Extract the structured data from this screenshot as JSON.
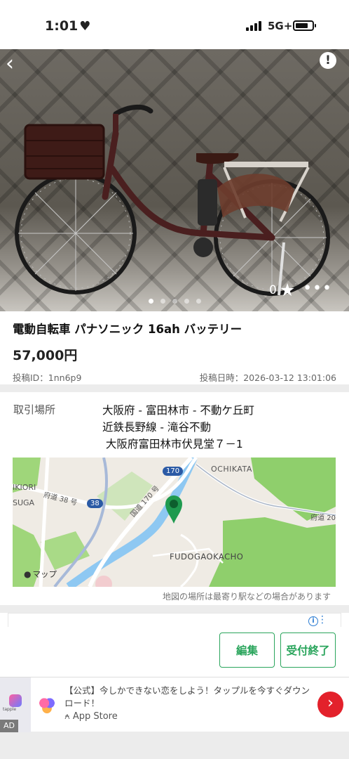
{
  "status_bar": {
    "time": "1:01",
    "network": "5G+",
    "heart_icon": "heart-icon",
    "battery_level_percent": 75
  },
  "photo": {
    "favorite_count": "0",
    "image_count": 5,
    "active_index": 0,
    "icons": {
      "back": "chevron-left-icon",
      "report": "exclamation-icon",
      "favorite": "star-icon",
      "more": "ellipsis-icon"
    }
  },
  "item": {
    "title": "電動自転車 パナソニック 16ah バッテリー",
    "price": "57,000円",
    "post_id": "投稿ID：1nn6p9",
    "post_date": "投稿日時：2026-03-12 13:01:06"
  },
  "place": {
    "label": "取引場所",
    "lines": [
      "大阪府 - 富田林市 - 不動ケ丘町",
      "近鉄長野線 - 滝谷不動",
      " 大阪府富田林市伏見堂７－1"
    ],
    "note": "地図の場所は最寄り駅などの場合があります"
  },
  "map": {
    "labels": {
      "ochikata": "OCHIKATA",
      "ikiori": "IKIORI",
      "suga": "SUGA",
      "route38": "府道 38 号",
      "route170": "国道 170 号",
      "prefroad": "府道 20",
      "fudoga": "FUDOGAOKACHO",
      "shield170": "170",
      "shield38": "38",
      "brand": "マップ"
    },
    "icons": {
      "pin": "map-pin-icon",
      "apple": "apple-icon"
    }
  },
  "actions": {
    "edit": "編集",
    "close": "受付終了"
  },
  "ad": {
    "badge": "AD",
    "thumb_name": "tapple",
    "text": "【公式】今しかできない恋をしよう！タップルを今すぐダウンロード！",
    "store": "App Store",
    "icons": {
      "info": "info-icon",
      "menu": "kebab-icon",
      "store": "app-store-icon",
      "go": "chevron-right-icon"
    }
  },
  "colors": {
    "accent_green": "#2aa55c",
    "map_pin": "#1f9a4f",
    "ad_button": "#e3212b",
    "info_blue": "#2b7cd3"
  }
}
